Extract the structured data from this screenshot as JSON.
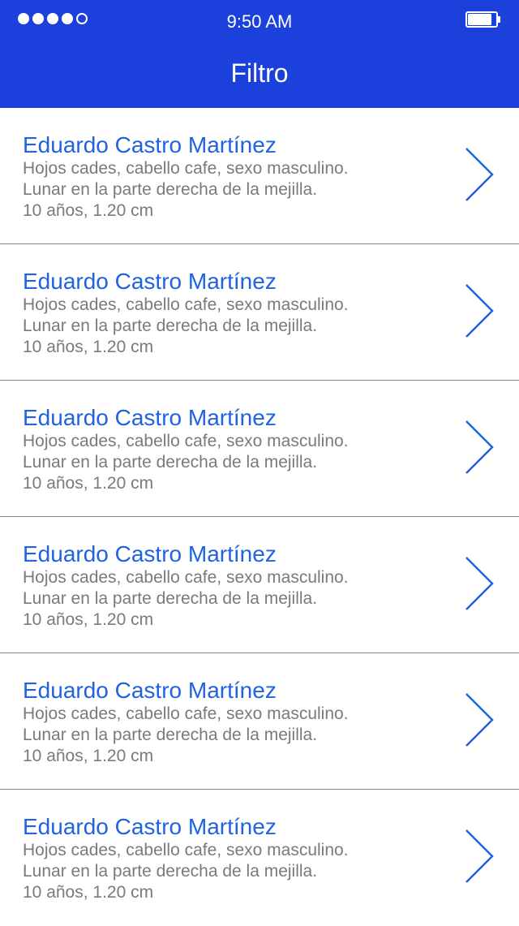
{
  "status_bar": {
    "time": "9:50 AM",
    "signal_filled": 4,
    "signal_total": 5,
    "battery_level": 0.85
  },
  "header": {
    "title": "Filtro",
    "background_color": "#1c40dc"
  },
  "list": {
    "items": [
      {
        "name": "Eduardo Castro Martínez",
        "line1": "Hojos cades, cabello cafe, sexo masculino.",
        "line2": "Lunar en la parte derecha de la mejilla.",
        "line3": "10 años, 1.20 cm",
        "icon": "chevron-right-icon"
      },
      {
        "name": "Eduardo Castro Martínez",
        "line1": "Hojos cades, cabello cafe, sexo masculino.",
        "line2": "Lunar en la parte derecha de la mejilla.",
        "line3": "10 años, 1.20 cm",
        "icon": "chevron-right-icon"
      },
      {
        "name": "Eduardo Castro Martínez",
        "line1": "Hojos cades, cabello cafe, sexo masculino.",
        "line2": "Lunar en la parte derecha de la mejilla.",
        "line3": "10 años, 1.20 cm",
        "icon": "chevron-right-icon"
      },
      {
        "name": "Eduardo Castro Martínez",
        "line1": "Hojos cades, cabello cafe, sexo masculino.",
        "line2": "Lunar en la parte derecha de la mejilla.",
        "line3": "10 años, 1.20 cm",
        "icon": "chevron-right-icon"
      },
      {
        "name": "Eduardo Castro Martínez",
        "line1": "Hojos cades, cabello cafe, sexo masculino.",
        "line2": "Lunar en la parte derecha de la mejilla.",
        "line3": "10 años, 1.20 cm",
        "icon": "chevron-right-icon"
      },
      {
        "name": "Eduardo Castro Martínez",
        "line1": "Hojos cades, cabello cafe, sexo masculino.",
        "line2": "Lunar en la parte derecha de la mejilla.",
        "line3": "10 años, 1.20 cm",
        "icon": "chevron-right-icon"
      }
    ],
    "name_color": "#2063e0",
    "detail_color": "#7a7a7a",
    "chevron_color": "#2063e0"
  }
}
